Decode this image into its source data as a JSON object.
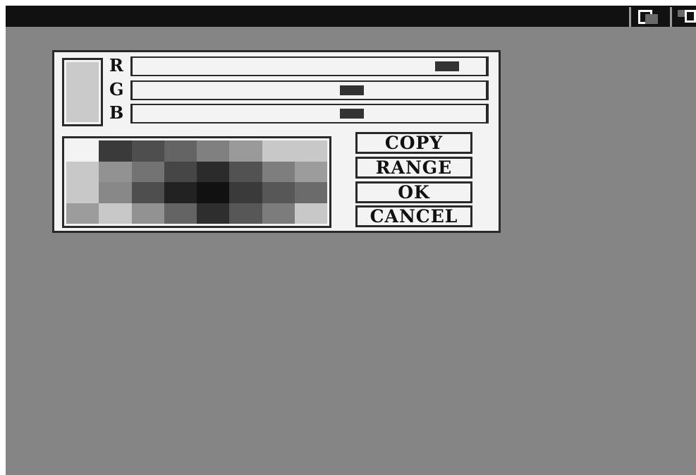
{
  "window": {
    "depth_gadget_icon": "depth-arrange-icon",
    "zoom_gadget_icon": "zoom-icon"
  },
  "colors": {
    "screen_bg": "#858585",
    "titlebar": "#111111",
    "dialog_bg": "#f3f3f3",
    "border": "#2a2a2a",
    "knob": "#333333"
  },
  "palette_dialog": {
    "current_color": "#cacaca",
    "sliders": [
      {
        "label": "R",
        "value": 0.89
      },
      {
        "label": "G",
        "value": 0.62
      },
      {
        "label": "B",
        "value": 0.62
      }
    ],
    "palette": [
      "#f3f3f3",
      "#3a3a3a",
      "#4e4e4e",
      "#646464",
      "#808080",
      "#9a9a9a",
      "#c8c8c8",
      "#c8c8c8",
      "#c8c8c8",
      "#929292",
      "#737373",
      "#464646",
      "#2b2b2b",
      "#525252",
      "#7e7e7e",
      "#9c9c9c",
      "#c8c8c8",
      "#888888",
      "#4e4e4e",
      "#222222",
      "#111111",
      "#3a3a3a",
      "#575757",
      "#6b6b6b",
      "#9c9c9c",
      "#c8c8c8",
      "#929292",
      "#646464",
      "#2e2e2e",
      "#575757",
      "#7c7c7c",
      "#c8c8c8"
    ],
    "buttons": {
      "copy": "COPY",
      "range": "RANGE",
      "ok": "OK",
      "cancel": "CANCEL"
    }
  }
}
